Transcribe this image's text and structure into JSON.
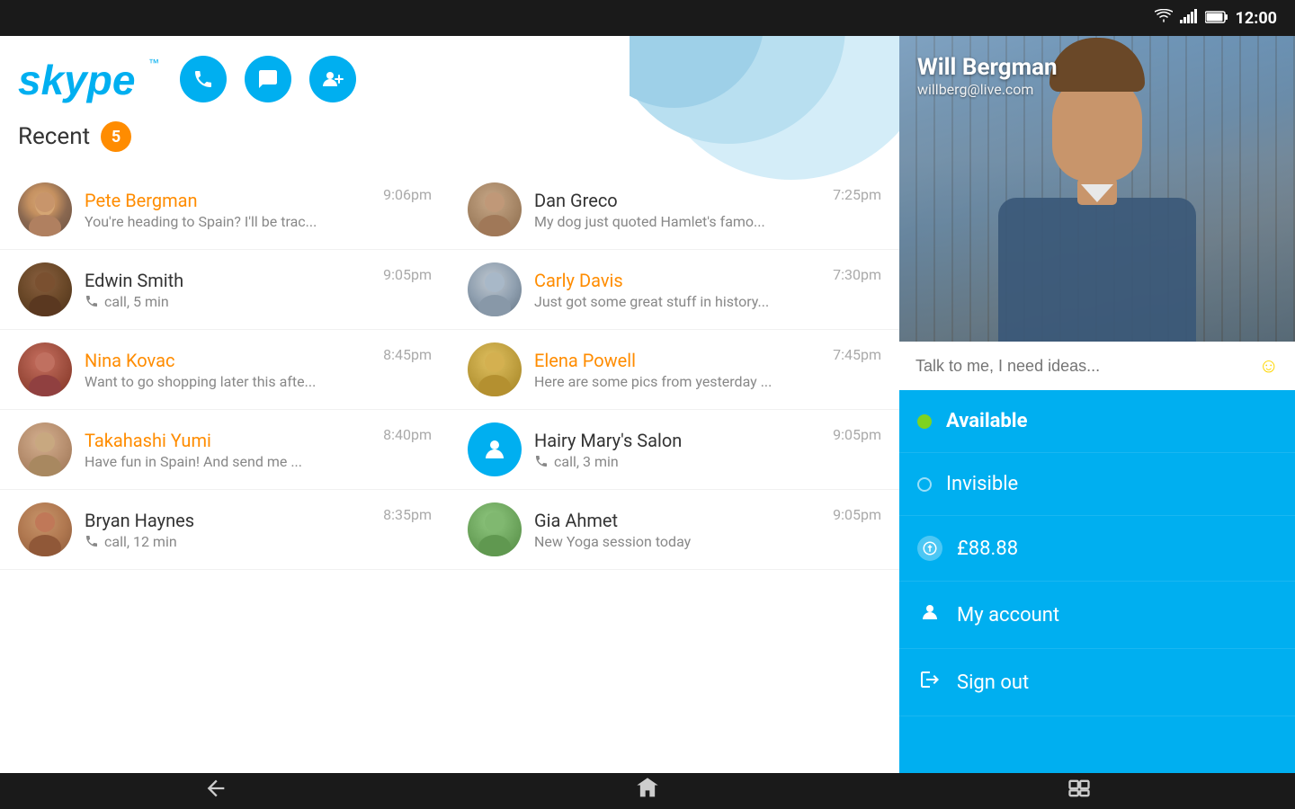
{
  "statusBar": {
    "time": "12:00",
    "wifi": "📶",
    "signal": "📶",
    "battery": "🔋"
  },
  "header": {
    "logo": "skype",
    "tm": "™",
    "buttons": {
      "call": "📞",
      "chat": "💬",
      "addContact": "👤+"
    }
  },
  "recent": {
    "label": "Recent",
    "badge": "5"
  },
  "leftChats": [
    {
      "name": "Pete Bergman",
      "online": true,
      "time": "9:06pm",
      "preview": "You're heading to Spain? I'll be trac...",
      "isCall": false,
      "avatarClass": "avatar-pete"
    },
    {
      "name": "Edwin Smith",
      "online": false,
      "time": "9:05pm",
      "preview": "call, 5 min",
      "isCall": true,
      "avatarClass": "avatar-edwin"
    },
    {
      "name": "Nina Kovac",
      "online": true,
      "time": "8:45pm",
      "preview": "Want to go shopping later this afte...",
      "isCall": false,
      "avatarClass": "avatar-nina"
    },
    {
      "name": "Takahashi Yumi",
      "online": true,
      "time": "8:40pm",
      "preview": "Have fun in Spain! And send me ...",
      "isCall": false,
      "avatarClass": "avatar-takahashi"
    },
    {
      "name": "Bryan Haynes",
      "online": false,
      "time": "8:35pm",
      "preview": "call, 12 min",
      "isCall": true,
      "avatarClass": "avatar-bryan"
    }
  ],
  "rightChats": [
    {
      "name": "Dan Greco",
      "online": false,
      "time": "7:25pm",
      "preview": "My dog just quoted Hamlet's famo...",
      "isCall": false,
      "avatarClass": "avatar-dan"
    },
    {
      "name": "Carly Davis",
      "online": true,
      "time": "7:30pm",
      "preview": "Just got some great stuff in history...",
      "isCall": false,
      "avatarClass": "avatar-carly"
    },
    {
      "name": "Elena Powell",
      "online": true,
      "time": "7:45pm",
      "preview": "Here are some pics from yesterday ...",
      "isCall": false,
      "avatarClass": "avatar-elena"
    },
    {
      "name": "Hairy Mary's Salon",
      "online": false,
      "time": "9:05pm",
      "preview": "call, 3 min",
      "isCall": true,
      "avatarClass": null
    },
    {
      "name": "Gia Ahmet",
      "online": false,
      "time": "9:05pm",
      "preview": "New Yoga session today",
      "isCall": false,
      "avatarClass": "avatar-gia"
    }
  ],
  "sidebar": {
    "profileName": "Will Bergman",
    "profileEmail": "willberg@live.com",
    "moodPlaceholder": "Talk to me, I need ideas...",
    "statusAvailable": "Available",
    "statusInvisible": "Invisible",
    "credit": "£88.88",
    "myAccount": "My account",
    "signOut": "Sign out"
  },
  "navBar": {
    "back": "←",
    "home": "⌂",
    "recents": "▭"
  }
}
